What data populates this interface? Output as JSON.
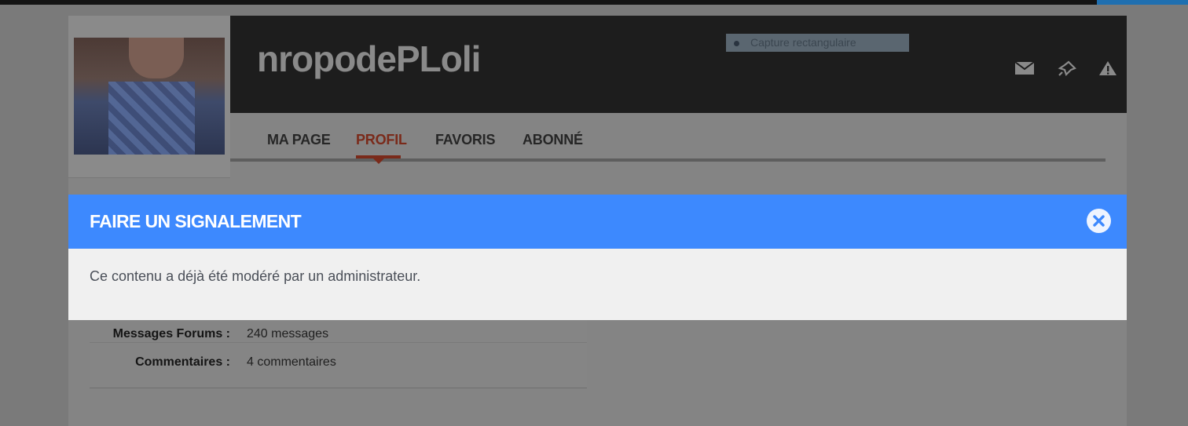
{
  "header": {
    "username": "nropodePLoli",
    "overlay_label": "Capture rectangulaire",
    "icons": [
      "mail-icon",
      "pin-icon",
      "warning-icon"
    ]
  },
  "nav": {
    "tabs": [
      {
        "label": "MA PAGE",
        "active": false
      },
      {
        "label": "PROFIL",
        "active": true
      },
      {
        "label": "FAVORIS",
        "active": false
      },
      {
        "label": "ABONNÉ",
        "active": false
      }
    ]
  },
  "stats": {
    "rows": [
      {
        "label": "Messages Forums :",
        "value": "240 messages"
      },
      {
        "label": "Commentaires :",
        "value": "4 commentaires"
      }
    ]
  },
  "modal": {
    "title": "FAIRE UN SIGNALEMENT",
    "message": "Ce contenu a déjà été modéré par un administrateur.",
    "close_icon": "close-icon"
  },
  "colors": {
    "modal_header": "#3d89fe",
    "active_tab": "#e0441c",
    "header_bg": "#1d1d1d"
  }
}
